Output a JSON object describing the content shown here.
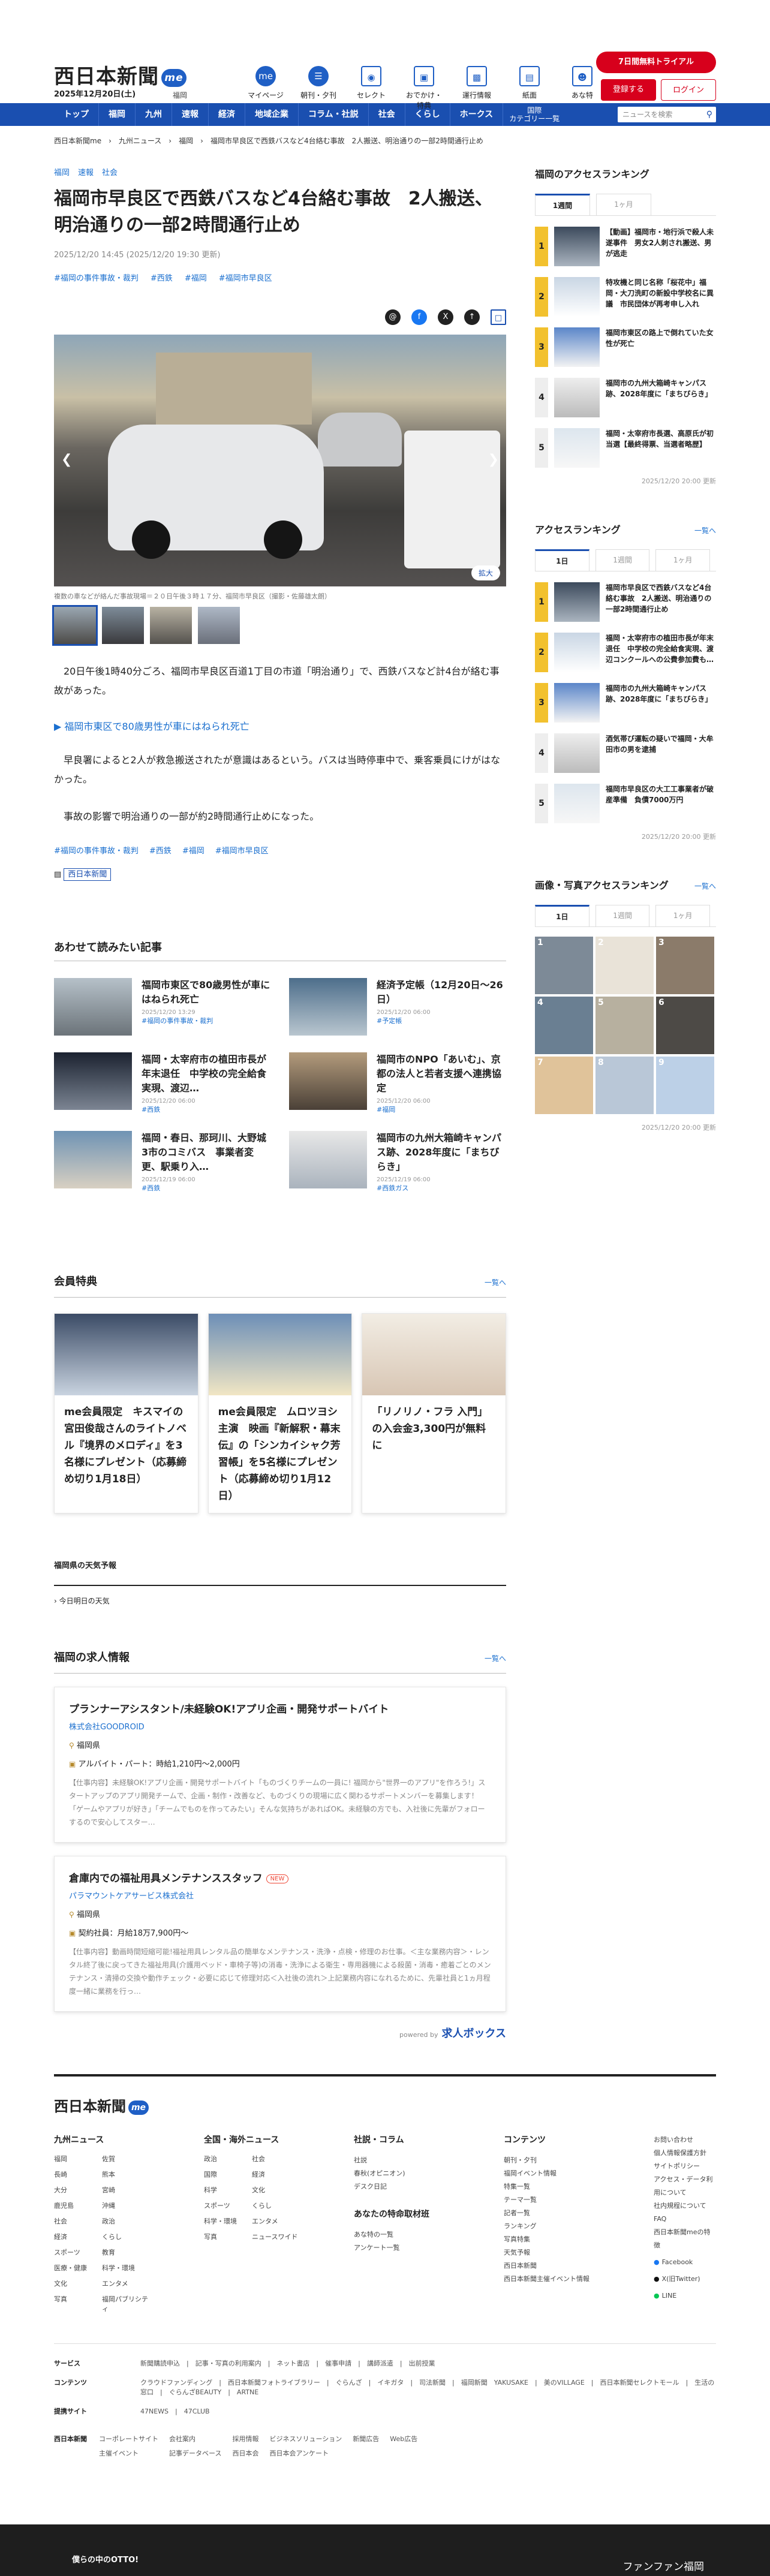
{
  "header": {
    "logo": "西日本新聞",
    "me": "me",
    "date": "2025年12月20日(土)",
    "area": "福岡",
    "nav": [
      {
        "icon": "me-icon",
        "label": "マイページ"
      },
      {
        "icon": "newspaper-icon",
        "label": "朝刊・夕刊"
      },
      {
        "icon": "select-icon",
        "label": "セレクト"
      },
      {
        "icon": "gift-icon",
        "label": "おでかけ・特典"
      },
      {
        "icon": "bus-icon",
        "label": "運行情報"
      },
      {
        "icon": "paper-icon",
        "label": "紙面"
      },
      {
        "icon": "cat-icon",
        "label": "あな特"
      }
    ],
    "trial": "7日間無料トライアル",
    "register": "登録する",
    "login": "ログイン"
  },
  "menu": [
    "トップ",
    "福岡",
    "九州",
    "速報",
    "経済",
    "地域企業",
    "コラム・社説",
    "社会",
    "くらし",
    "ホークス"
  ],
  "menu_extra": "国際\nカテゴリー一覧",
  "search_placeholder": "ニュースを検索",
  "breadcrumb": [
    "西日本新聞me",
    "九州ニュース",
    "福岡",
    "福岡市早良区で西鉄バスなど4台絡む事故　2人搬送、明治通りの一部2時間通行止め"
  ],
  "article": {
    "tags": [
      "福岡",
      "速報",
      "社会"
    ],
    "title": "福岡市早良区で西鉄バスなど4台絡む事故　2人搬送、明治通りの一部2時間通行止め",
    "date": "2025/12/20 14:45 (2025/12/20 19:30 更新)",
    "hashtags": [
      "#福岡の事件事故・裁判",
      "#西鉄",
      "#福岡",
      "#福岡市早良区"
    ],
    "zoom": "拡大",
    "caption": "複数の車などが絡んだ事故現場＝２０日午後３時１７分、福岡市早良区（撮影・佐藤雄太朗）",
    "p1": "20日午後1時40分ごろ、福岡市早良区百道1丁目の市道「明治通り」で、西鉄バスなど計4台が絡む事故があった。",
    "related": "▶ 福岡市東区で80歳男性が車にはねられ死亡",
    "p2": "早良署によると2人が救急搬送されたが意識はあるという。バスは当時停車中で、乗客乗員にけがはなかった。",
    "p3": "事故の影響で明治通りの一部が約2時間通行止めになった。",
    "btags": [
      "#福岡の事件事故・裁判",
      "#西鉄",
      "#福岡",
      "#福岡市早良区"
    ],
    "publisher": "西日本新聞"
  },
  "also": {
    "heading": "あわせて読みたい記事",
    "items": [
      {
        "title": "福岡市東区で80歳男性が車にはねられ死亡",
        "date": "2025/12/20 13:29",
        "tag": "#福岡の事件事故・裁判"
      },
      {
        "title": "経済予定帳（12月20日～26日）",
        "date": "2025/12/20 06:00",
        "tag": "#予定帳"
      },
      {
        "title": "福岡・太宰府市の植田市長が年末退任　中学校の完全給食実現、渡辺…",
        "date": "2025/12/20 06:00",
        "tag": "#西鉄"
      },
      {
        "title": "福岡市のNPO「あいむ」、京都の法人と若者支援へ連携協定",
        "date": "2025/12/20 06:00",
        "tag": "#福岡"
      },
      {
        "title": "福岡・春日、那珂川、大野城3市のコミバス　事業者変更、駅乗り入…",
        "date": "2025/12/19 06:00",
        "tag": "#西鉄"
      },
      {
        "title": "福岡市の九州大箱崎キャンパス跡、2028年度に「まちびらき」",
        "date": "2025/12/19 06:00",
        "tag": "#西鉄ガス"
      }
    ]
  },
  "perks": {
    "heading": "会員特典",
    "more": "一覧へ",
    "items": [
      "me会員限定　キスマイの宮田俊哉さんのライトノベル『境界のメロディ』を3名様にプレゼント（応募締め切り1月18日）",
      "me会員限定　ムロツヨシ主演　映画『新解釈・幕末伝』の「シンカイシャク芳習帳」を5名様にプレゼント（応募締め切り1月12日）",
      "「リノリノ・フラ 入門」の入会金3,300円が無料に"
    ]
  },
  "weather": {
    "heading": "福岡県の天気予報",
    "link": "今日明日の天気"
  },
  "jobs": {
    "heading": "福岡の求人情報",
    "more": "一覧へ",
    "items": [
      {
        "title": "プランナーアシスタント/未経験OK!アプリ企画・開発サポートバイト",
        "new": "",
        "company": "株式会社GOODROID",
        "place": "福岡県",
        "pay": "アルバイト・パート：時給1,210円～2,000円",
        "desc": "【仕事内容】未経験OK!アプリ企画・開発サポートバイト「ものづくりチームの一員に! 福岡から\"世界一のアプリ\"を作ろう!」スタートアップのアプリ開発チームで、企画・制作・改善など、ものづくりの現場に広く関わるサポートメンバーを募集します！「ゲームやアプリが好き」「チームでものを作ってみたい」そんな気持ちがあればOK。未経験の方でも、入社後に先輩がフォローするので安心してスター…"
      },
      {
        "title": "倉庫内での福祉用具メンテナンススタッフ",
        "new": "NEW",
        "company": "パラマウントケアサービス株式会社",
        "place": "福岡県",
        "pay": "契約社員：月給18万7,900円～",
        "desc": "【仕事内容】動画時間短縮可能!福祉用具レンタル品の簡単なメンテナンス・洗浄・点検・修理のお仕事。＜主な業務内容＞・レンタル終了後に戻ってきた福祉用具(介護用ベッド・車椅子等)の消毒・洗浄による衛生・専用器機による殺菌・消毒・癒着ごとのメンテナンス・清掃の交換や動作チェック・必要に応じて修理対応＜入社後の流れ＞上記業務内容になれるために、先輩社員と1ヵ月程度一緒に業務を行っ…"
      }
    ],
    "powered": "powered by",
    "brand": "求人ボックス"
  },
  "sidebar": {
    "access_heading": "福岡のアクセスランキング",
    "tabs1": [
      "1週間",
      "1ヶ月"
    ],
    "rank1": [
      {
        "n": "1",
        "title": "【動画】福岡市・地行浜で殺人未遂事件　男女2人刺され搬送、男が逃走"
      },
      {
        "n": "2",
        "title": "特攻機と同じ名称「桜花中」福岡・大刀洗町の新設中学校名に異議　市民団体が再考申し入れ"
      },
      {
        "n": "3",
        "title": "福岡市東区の路上で倒れていた女性が死亡"
      },
      {
        "n": "4",
        "title": "福岡市の九州大箱崎キャンパス跡、2028年度に「まちびらき」"
      },
      {
        "n": "5",
        "title": "福岡・太宰府市長選、高原氏が初当選【最終得票、当選者略歴】"
      }
    ],
    "upd1": "2025/12/20 20:00 更新",
    "all_heading": "アクセスランキング",
    "all_more": "一覧へ",
    "tabs2": [
      "1日",
      "1週間",
      "1ヶ月"
    ],
    "rank2": [
      {
        "n": "1",
        "title": "福岡市早良区で西鉄バスなど4台絡む事故　2人搬送、明治通りの一部2時間通行止め"
      },
      {
        "n": "2",
        "title": "福岡・太宰府市の植田市長が年末退任　中学校の完全給食実現、渡辺コンクールへの公費参加費も…"
      },
      {
        "n": "3",
        "title": "福岡市の九州大箱崎キャンパス跡、2028年度に「まちびらき」"
      },
      {
        "n": "4",
        "title": "酒気帯び運転の疑いで福岡・大牟田市の男を逮捕"
      },
      {
        "n": "5",
        "title": "福岡市早良区の大工工事業者が破産準備　負債7000万円"
      }
    ],
    "upd2": "2025/12/20 20:00 更新",
    "photo_heading": "画像・写真アクセスランキング",
    "photo_more": "一覧へ",
    "tabs3": [
      "1日",
      "1週間",
      "1ヶ月"
    ],
    "photo_nums": [
      "1",
      "2",
      "3",
      "4",
      "5",
      "6",
      "7",
      "8",
      "9"
    ],
    "upd3": "2025/12/20 20:00 更新"
  },
  "footer": {
    "logo": "西日本新聞",
    "cols": [
      {
        "h": "九州ニュース",
        "items": [
          "福岡",
          "佐賀",
          "長崎",
          "熊本",
          "大分",
          "宮崎",
          "鹿児島",
          "沖縄",
          "社会",
          "政治",
          "経済",
          "くらし",
          "スポーツ",
          "教育",
          "医療・健康",
          "科学・環境",
          "文化",
          "エンタメ",
          "写真",
          "福岡パブリシティ"
        ]
      },
      {
        "h": "全国・海外ニュース",
        "items": [
          "政治",
          "社会",
          "国際",
          "経済",
          "科学",
          "文化",
          "スポーツ",
          "くらし",
          "科学・環境",
          "エンタメ",
          "写真",
          "ニュースワイド"
        ]
      },
      {
        "h": "社説・コラム",
        "items": [
          "社説",
          "春秋(オピニオン)",
          "デスク日記"
        ]
      },
      {
        "h": "あなたの特命取材班",
        "items": [
          "あな特の一覧",
          "アンケート一覧"
        ]
      },
      {
        "h": "コンテンツ",
        "items": [
          "朝刊・夕刊",
          "福岡イベント情報",
          "特集一覧",
          "テーマ一覧",
          "記者一覧",
          "ランキング",
          "写真特集",
          "天気予報",
          "西日本新聞",
          "西日本新聞主催イベント情報"
        ]
      }
    ],
    "help": [
      "お問い合わせ",
      "個人情報保護方針",
      "サイトポリシー",
      "アクセス・データ利用について",
      "社内規程について",
      "FAQ",
      "西日本新聞meの特徴"
    ],
    "social": [
      "Facebook",
      "X(旧Twitter)",
      "LINE"
    ],
    "rows": [
      {
        "h": "サービス",
        "v": "新聞購読申込　|　記事・写真の利用案内　|　ネット書店　|　催事申請　|　講師派遣　|　出前授業"
      },
      {
        "h": "コンテンツ",
        "v": "クラウドファンディング　|　西日本新聞フォトライブラリー　|　ぐらんざ　|　イキガタ　|　司法新聞　|　福岡新聞　YAKUSAKE　|　美のVILLAGE　|　西日本新聞セレクトモール　|　生活の窓口　|　ぐらんざBEAUTY　|　ARTNE"
      },
      {
        "h": "提携サイト",
        "v": "47NEWS　|　47CLUB"
      }
    ],
    "corp_logo": "西日本新聞",
    "corp": [
      "コーポレートサイト",
      "会社案内",
      "採用情報",
      "ビジネスソリューション",
      "新聞広告",
      "Web広告",
      "主催イベント",
      "記事データベース",
      "西日本会",
      "西日本会アンケート"
    ]
  },
  "banner": {
    "left": "僕らの中のOTTO!",
    "right": "ファンファン福岡"
  }
}
